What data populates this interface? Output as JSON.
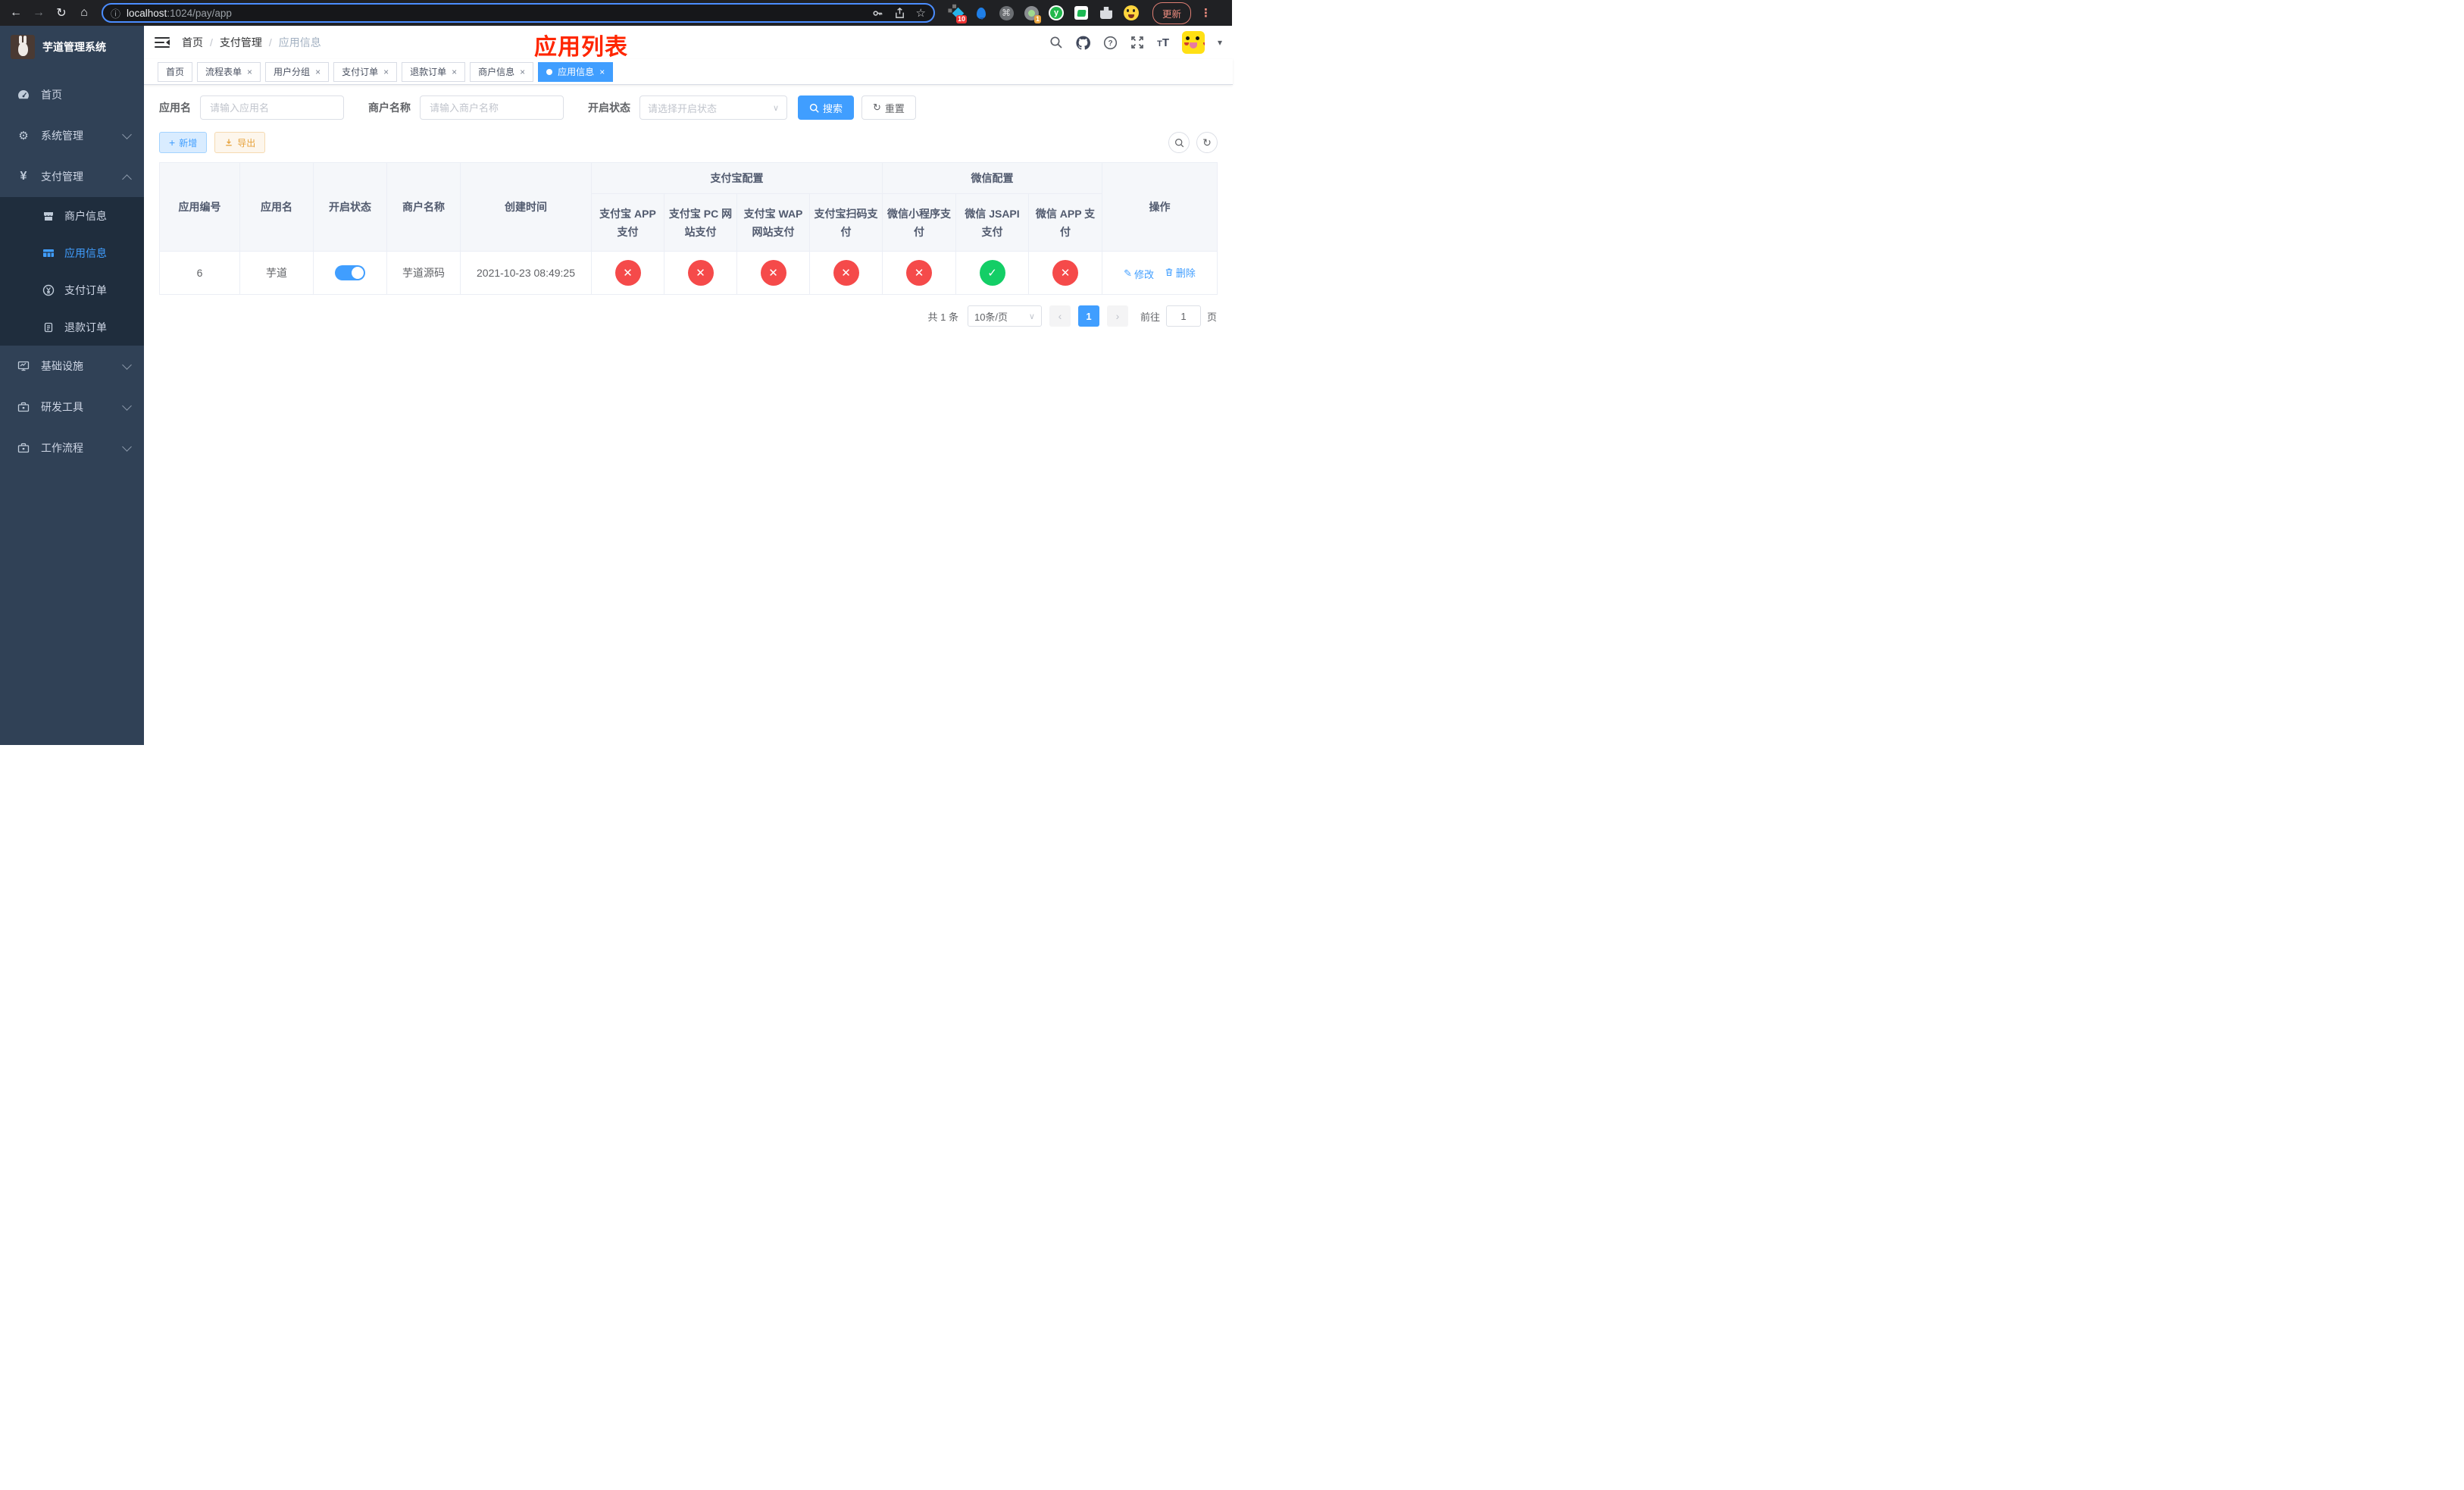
{
  "browser": {
    "url_host": "localhost",
    "url_path": ":1024/pay/app",
    "info_icon": "ⓘ",
    "star_icon": "☆",
    "back_icon": "←",
    "forward_icon": "→",
    "reload_icon": "↻",
    "home_icon": "⌂",
    "command_icon": "⌘",
    "ext_badge_pin": "10",
    "ext_badge_cam": "1",
    "ext_y_letter": "y",
    "update_button": "更新",
    "menu_dots": "⋮"
  },
  "sidebar": {
    "title": "芋道管理系统",
    "yen_glyph": "¥",
    "gear_glyph": "⚙",
    "items": {
      "home": "首页",
      "system": "系统管理",
      "payment": "支付管理",
      "merchant": "商户信息",
      "appinfo": "应用信息",
      "payorder": "支付订单",
      "refund": "退款订单",
      "infra": "基础设施",
      "devtools": "研发工具",
      "workflow": "工作流程"
    }
  },
  "header": {
    "breadcrumb": [
      "首页",
      "支付管理",
      "应用信息"
    ],
    "separator": "/",
    "page_title": "应用列表",
    "caret": "▾"
  },
  "tabs": {
    "close_glyph": "×",
    "items": [
      {
        "label": "首页",
        "closable": false,
        "active": false
      },
      {
        "label": "流程表单",
        "closable": true,
        "active": false
      },
      {
        "label": "用户分组",
        "closable": true,
        "active": false
      },
      {
        "label": "支付订单",
        "closable": true,
        "active": false
      },
      {
        "label": "退款订单",
        "closable": true,
        "active": false
      },
      {
        "label": "商户信息",
        "closable": true,
        "active": false
      },
      {
        "label": "应用信息",
        "closable": true,
        "active": true
      }
    ]
  },
  "filters": {
    "app_name_label": "应用名",
    "app_name_placeholder": "请输入应用名",
    "merchant_label": "商户名称",
    "merchant_placeholder": "请输入商户名称",
    "status_label": "开启状态",
    "status_placeholder": "请选择开启状态",
    "select_caret": "∨",
    "search_button": "搜索",
    "reset_button": "重置",
    "reset_icon": "↻"
  },
  "toolbar": {
    "add_button": "新增",
    "add_icon": "+",
    "export_button": "导出",
    "refresh_icon": "↻"
  },
  "table": {
    "col_app_id": "应用编号",
    "col_app_name": "应用名",
    "col_status": "开启状态",
    "col_merchant": "商户名称",
    "col_created": "创建时间",
    "group_alipay": "支付宝配置",
    "group_wechat": "微信配置",
    "col_alipay_app": "支付宝 APP 支付",
    "col_alipay_pc": "支付宝 PC 网站支付",
    "col_alipay_wap": "支付宝 WAP 网站支付",
    "col_alipay_qr": "支付宝扫码支付",
    "col_wx_mini": "微信小程序支付",
    "col_wx_jsapi": "微信 JSAPI 支付",
    "col_wx_app": "微信 APP 支付",
    "col_actions": "操作",
    "row": {
      "app_id": "6",
      "app_name": "芋道",
      "status": "on",
      "merchant": "芋道源码",
      "created": "2021-10-23 08:49:25",
      "configs": [
        "fail",
        "fail",
        "fail",
        "fail",
        "fail",
        "success",
        "fail"
      ],
      "edit_label": "修改",
      "edit_icon": "✎",
      "delete_label": "删除"
    }
  },
  "pagination": {
    "total": "共 1 条",
    "page_size": "10条/页",
    "select_caret": "∨",
    "prev_glyph": "‹",
    "next_glyph": "›",
    "current_page": "1",
    "goto_prefix": "前往",
    "goto_value": "1",
    "goto_suffix": "页"
  },
  "colors": {
    "accent_blue": "#409eff",
    "danger_red": "#f54a4a",
    "success_green": "#13ce66",
    "title_red": "#ff2600",
    "sidebar_bg": "#304156",
    "submenu_bg": "#1f2d3d"
  }
}
